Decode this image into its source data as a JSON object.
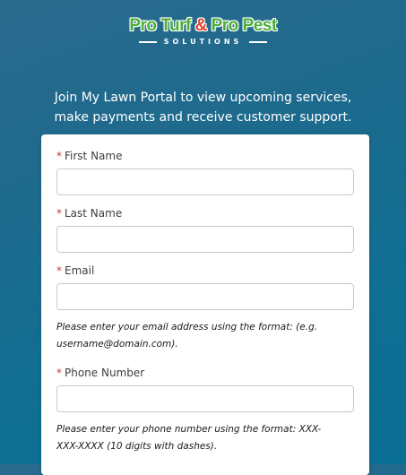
{
  "logo": {
    "part1": "Pro Turf ",
    "amp": "&",
    "part2": " Pro Pest",
    "subtitle": "SOLUTIONS"
  },
  "intro": {
    "line1": "Join My Lawn Portal to view upcoming services,",
    "line2": "make payments and receive customer support."
  },
  "form": {
    "required_marker": "*",
    "first_name": {
      "label": "First Name",
      "value": "",
      "placeholder": ""
    },
    "last_name": {
      "label": "Last Name",
      "value": "",
      "placeholder": ""
    },
    "email": {
      "label": "Email",
      "value": "",
      "placeholder": "",
      "help_line1": "Please enter your email address using the format: (e.g.",
      "help_line2": "username@domain.com)."
    },
    "phone": {
      "label": "Phone Number",
      "value": "",
      "placeholder": "",
      "help_line1": "Please enter your phone number using the format: XXX-",
      "help_line2": "XXX-XXXX (10 digits with dashes)."
    }
  },
  "colors": {
    "background": "#1d6a8d",
    "logo_green": "#4caf3a",
    "logo_red": "#e8412c",
    "required_red": "#c23934"
  }
}
